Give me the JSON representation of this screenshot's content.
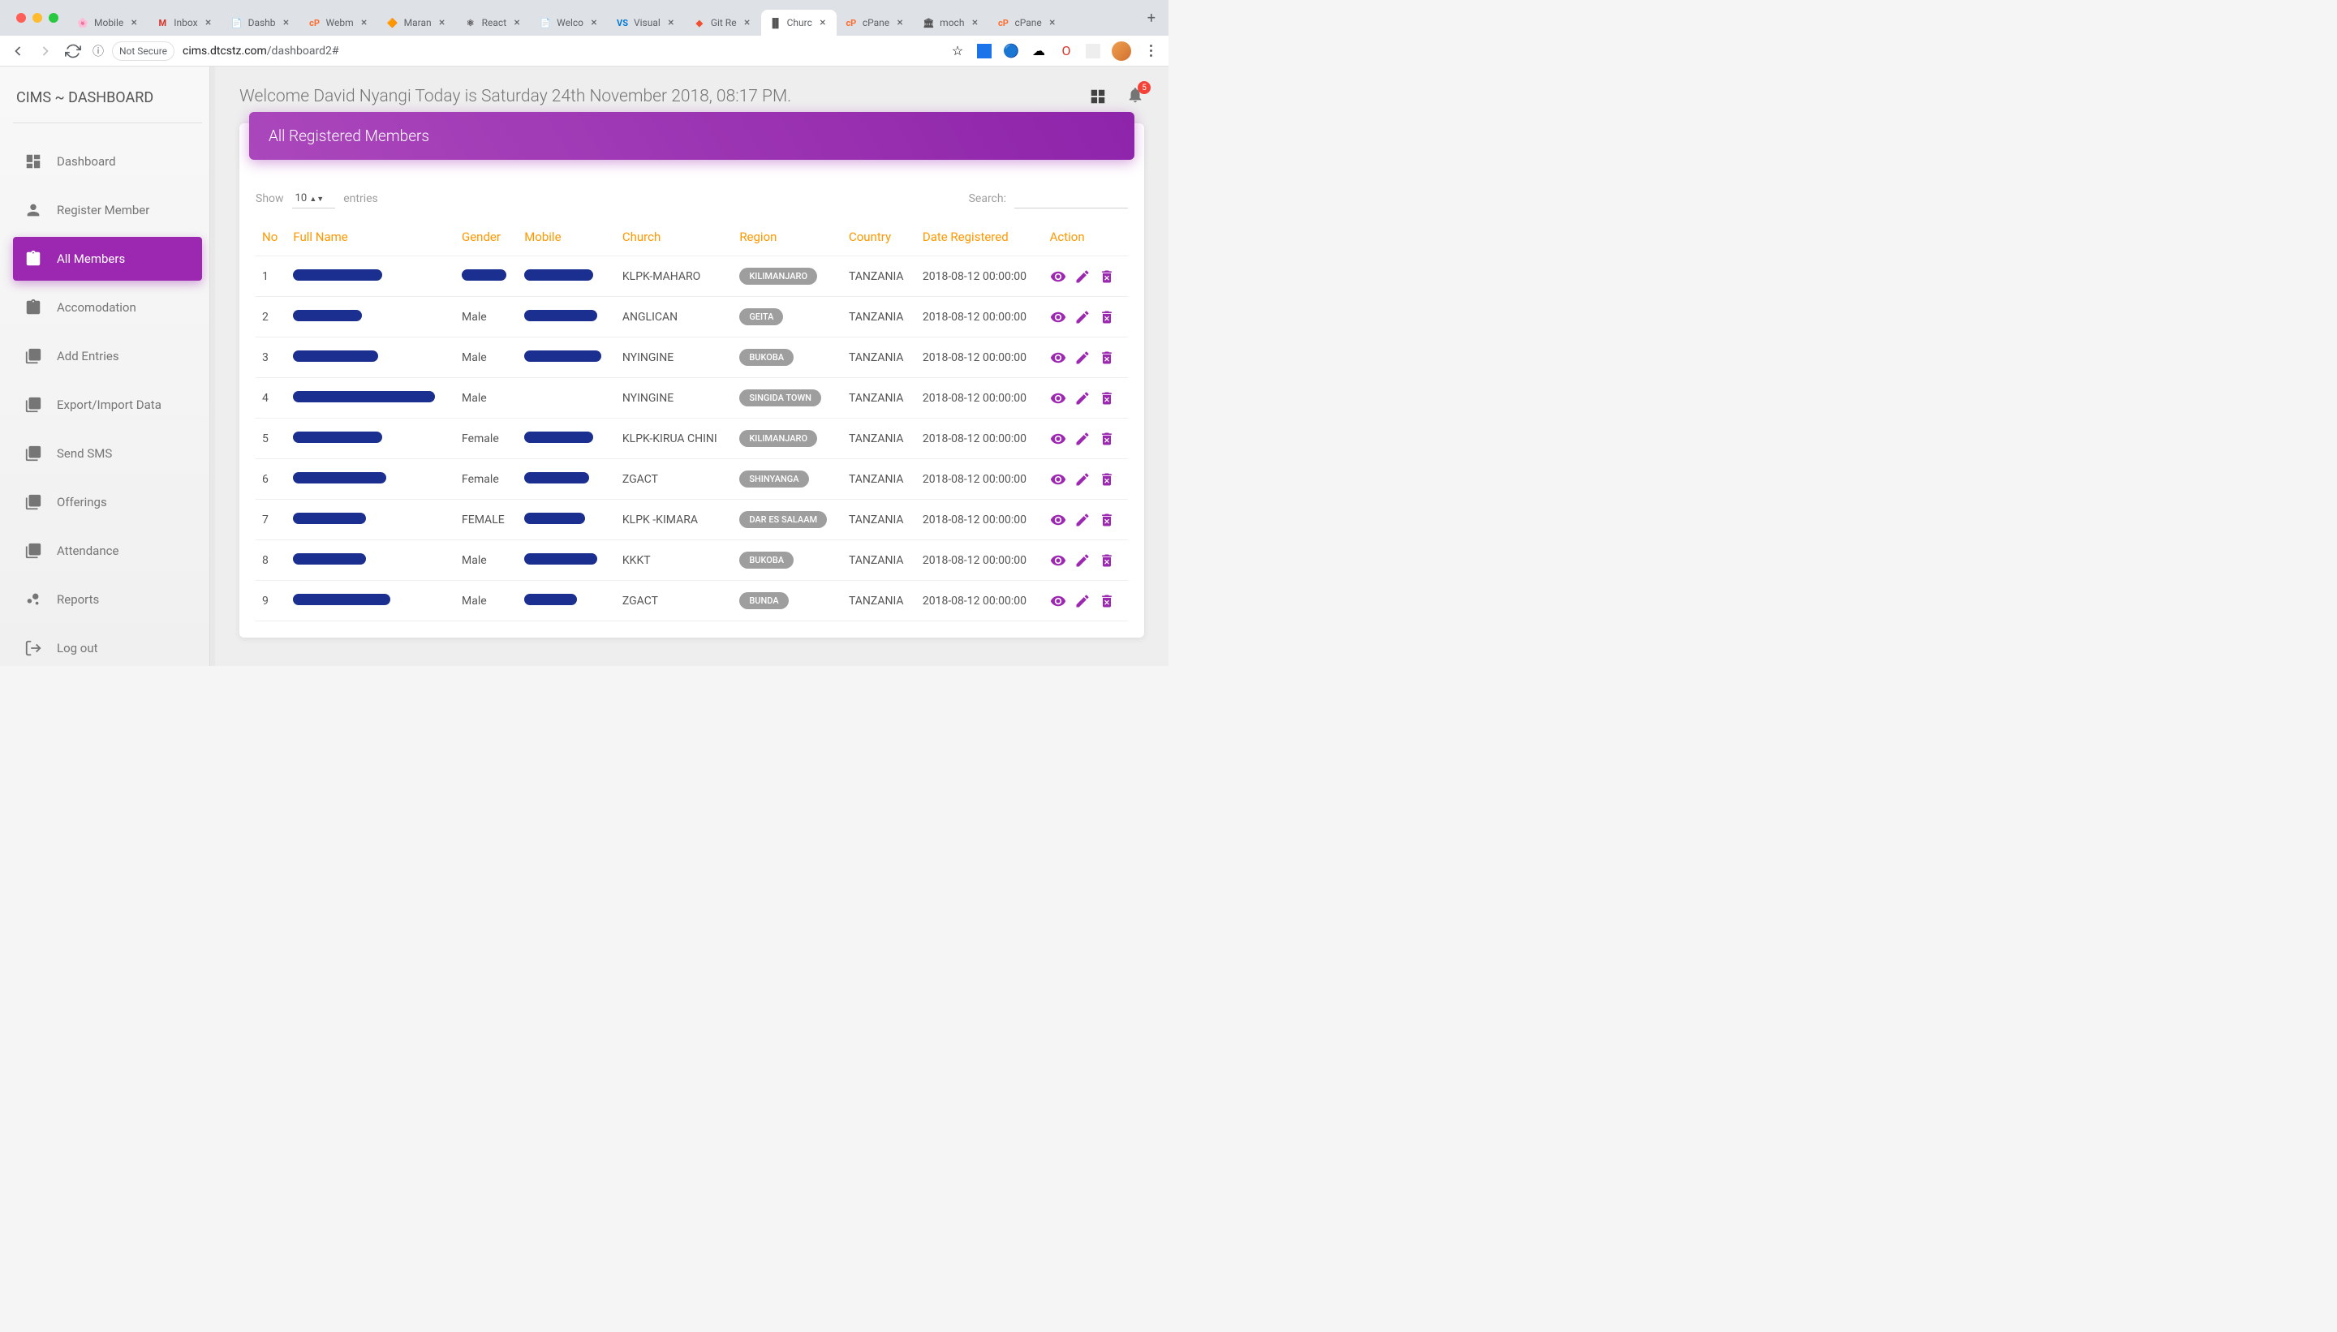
{
  "browser": {
    "tabs": [
      {
        "favicon": "🌸",
        "title": "Mobile"
      },
      {
        "favicon": "M",
        "title": "Inbox",
        "fcolor": "#d93025"
      },
      {
        "favicon": "📄",
        "title": "Dashb"
      },
      {
        "favicon": "cP",
        "title": "Webm",
        "fcolor": "#ff6c2c"
      },
      {
        "favicon": "🔶",
        "title": "Maran"
      },
      {
        "favicon": "⚛",
        "title": "React"
      },
      {
        "favicon": "📄",
        "title": "Welco"
      },
      {
        "favicon": "VS",
        "title": "Visual",
        "fcolor": "#0078d7"
      },
      {
        "favicon": "◆",
        "title": "Git Re",
        "fcolor": "#f05033"
      },
      {
        "favicon": "▐▌",
        "title": "Churc",
        "active": true
      },
      {
        "favicon": "cP",
        "title": "cPane",
        "fcolor": "#ff6c2c"
      },
      {
        "favicon": "🏛",
        "title": "moch"
      },
      {
        "favicon": "cP",
        "title": "cPane",
        "fcolor": "#ff6c2c"
      }
    ],
    "not_secure": "Not Secure",
    "url_host": "cims.dtcstz.com",
    "url_path": "/dashboard2#"
  },
  "sidebar": {
    "brand": "CIMS ~ DASHBOARD",
    "items": [
      {
        "label": "Dashboard",
        "icon": "dashboard"
      },
      {
        "label": "Register Member",
        "icon": "person"
      },
      {
        "label": "All Members",
        "icon": "clipboard",
        "active": true
      },
      {
        "label": "Accomodation",
        "icon": "clipboard"
      },
      {
        "label": "Add Entries",
        "icon": "library"
      },
      {
        "label": "Export/Import Data",
        "icon": "library"
      },
      {
        "label": "Send SMS",
        "icon": "library"
      },
      {
        "label": "Offerings",
        "icon": "library"
      },
      {
        "label": "Attendance",
        "icon": "library"
      },
      {
        "label": "Reports",
        "icon": "bubble"
      },
      {
        "label": "Log out",
        "icon": "logout"
      }
    ]
  },
  "header": {
    "welcome": "Welcome David Nyangi Today is Saturday 24th November 2018, 08:17 PM.",
    "badge": "5"
  },
  "card": {
    "title": "All Registered Members",
    "show_label": "Show",
    "entries_value": "10",
    "entries_label": "entries",
    "search_label": "Search:"
  },
  "table": {
    "columns": [
      "No",
      "Full Name",
      "Gender",
      "Mobile",
      "Church",
      "Region",
      "Country",
      "Date Registered",
      "Action"
    ],
    "rows": [
      {
        "no": "1",
        "name_w": 110,
        "gender_redact": true,
        "gender": "",
        "mobile_w": 85,
        "church": "KLPK-MAHARO",
        "region": "KILIMANJARO",
        "country": "TANZANIA",
        "date": "2018-08-12 00:00:00"
      },
      {
        "no": "2",
        "name_w": 85,
        "gender": "Male",
        "mobile_w": 90,
        "church": "ANGLICAN",
        "region": "GEITA",
        "country": "TANZANIA",
        "date": "2018-08-12 00:00:00"
      },
      {
        "no": "3",
        "name_w": 105,
        "gender": "Male",
        "mobile_w": 95,
        "church": "NYINGINE",
        "region": "BUKOBA",
        "country": "TANZANIA",
        "date": "2018-08-12 00:00:00"
      },
      {
        "no": "4",
        "name_w": 175,
        "gender": "Male",
        "mobile_w": 0,
        "church": "NYINGINE",
        "region": "SINGIDA TOWN",
        "country": "TANZANIA",
        "date": "2018-08-12 00:00:00"
      },
      {
        "no": "5",
        "name_w": 110,
        "gender": "Female",
        "mobile_w": 85,
        "church": "KLPK-KIRUA CHINI",
        "region": "KILIMANJARO",
        "country": "TANZANIA",
        "date": "2018-08-12 00:00:00"
      },
      {
        "no": "6",
        "name_w": 115,
        "gender": "Female",
        "mobile_w": 80,
        "church": "ZGACT",
        "region": "SHINYANGA",
        "country": "TANZANIA",
        "date": "2018-08-12 00:00:00"
      },
      {
        "no": "7",
        "name_w": 90,
        "gender": "FEMALE",
        "mobile_w": 75,
        "church": "KLPK -KIMARA",
        "region": "DAR ES SALAAM",
        "country": "TANZANIA",
        "date": "2018-08-12 00:00:00"
      },
      {
        "no": "8",
        "name_w": 90,
        "gender": "Male",
        "mobile_w": 90,
        "church": "KKKT",
        "region": "BUKOBA",
        "country": "TANZANIA",
        "date": "2018-08-12 00:00:00"
      },
      {
        "no": "9",
        "name_w": 120,
        "gender": "Male",
        "mobile_w": 65,
        "church": "ZGACT",
        "region": "BUNDA",
        "country": "TANZANIA",
        "date": "2018-08-12 00:00:00"
      }
    ]
  }
}
